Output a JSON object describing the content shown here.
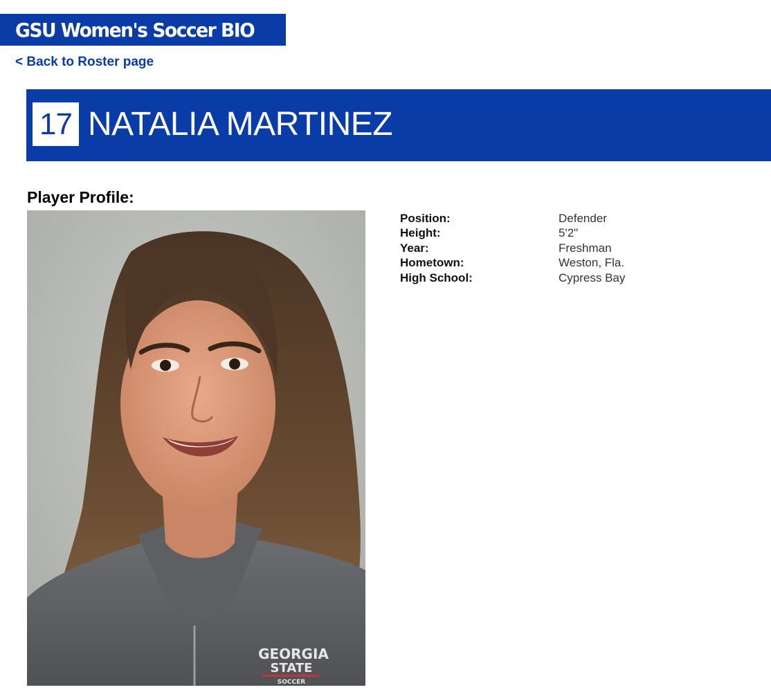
{
  "site": {
    "banner_title": "GSU Women's Soccer BIO",
    "back_link": "< Back to Roster page",
    "brand_color": "#0a3ca8"
  },
  "player": {
    "number": "17",
    "name": "NATALIA MARTINEZ"
  },
  "profile": {
    "heading": "Player Profile:",
    "fields": [
      {
        "label": "Position:",
        "value": "Defender"
      },
      {
        "label": "Height:",
        "value": "5'2\""
      },
      {
        "label": "Year:",
        "value": "Freshman"
      },
      {
        "label": "Hometown:",
        "value": "Weston, Fla."
      },
      {
        "label": "High School:",
        "value": "Cypress Bay"
      }
    ]
  },
  "photo": {
    "jacket_logo": [
      "GEORGIA",
      "STATE",
      "SOCCER"
    ]
  }
}
